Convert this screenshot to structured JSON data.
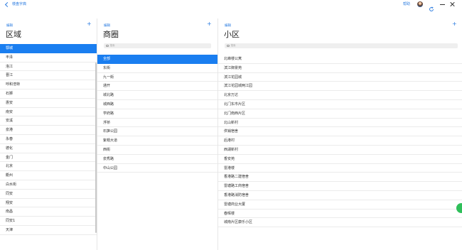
{
  "header": {
    "back_label": "楼盘字典",
    "help_label": "帮助"
  },
  "panels": {
    "region": {
      "edit_label": "编辑",
      "add_label": "+",
      "title": "区域",
      "items": [
        "鄂城",
        "丰泽",
        "洛江",
        "晋江",
        "呼和浩特",
        "石狮",
        "惠安",
        "南安",
        "安溪",
        "泉港",
        "永春",
        "德化",
        "金门",
        "北京",
        "衢州",
        "白水街",
        "同安",
        "翔安",
        "南昌",
        "同安1",
        "天津"
      ],
      "selected_index": 0
    },
    "district": {
      "edit_label": "编辑",
      "add_label": "+",
      "title": "商圈",
      "search_placeholder": "搜索",
      "items": [
        "全部",
        "东街",
        "九一街",
        "通开",
        "城北路",
        "城西路",
        "学府路",
        "浮桥",
        "石笋公园",
        "紫帽大道",
        "西街",
        "泉秀路",
        "中山公园"
      ],
      "selected_index": 0
    },
    "community": {
      "edit_label": "编辑",
      "add_label": "+",
      "title": "小区",
      "search_placeholder": "搜索",
      "items": [
        "北峰楼公寓",
        "滨江御景苑",
        "滨江花园城",
        "滨江花园城两江园",
        "北京万达",
        "北门东市片区",
        "北门南西片区",
        "北山新村",
        "供销宿舍",
        "后港村",
        "西湖新村",
        "香安苑",
        "雷港楼",
        "香港路二建宿舍",
        "雷塘路工商宿舍",
        "香港路消防宿舍",
        "雷塘商业大厦",
        "春晖楼",
        "城南片区康乐小区"
      ]
    }
  },
  "colors": {
    "accent": "#1a7ef0",
    "link": "#2a7be0",
    "fab": "#2fbf5a"
  }
}
